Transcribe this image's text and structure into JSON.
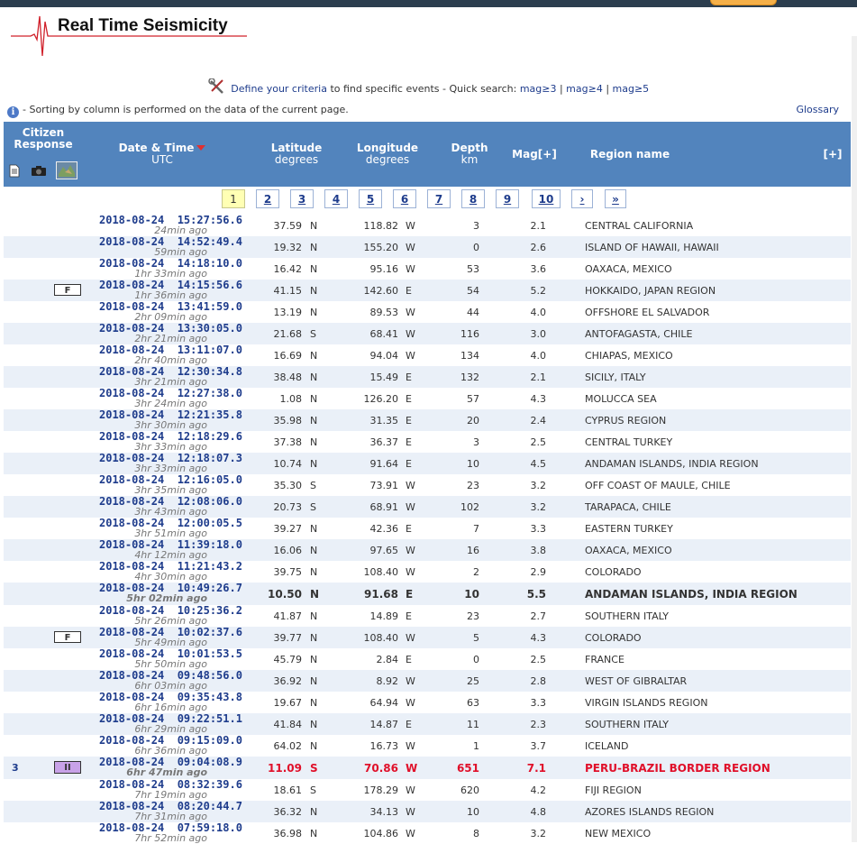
{
  "header": {
    "title": "Real Time Seismicity",
    "criteria_link": "Define your criteria",
    "criteria_text": " to find specific events - Quick search: ",
    "quick": [
      "mag≥3",
      "mag≥4",
      "mag≥5"
    ],
    "sep": " | ",
    "info_text": "- Sorting by column is performed on the data of the current page.",
    "glossary": "Glossary"
  },
  "table_header": {
    "citizen": "Citizen",
    "response": "Response",
    "date_time": "Date & Time",
    "utc": "UTC",
    "latitude": "Latitude",
    "lat_unit": "degrees",
    "longitude": "Longitude",
    "lon_unit": "degrees",
    "depth": "Depth",
    "depth_unit": "km",
    "mag": "Mag[+]",
    "region": "Region name",
    "expand": "[+]"
  },
  "pager": [
    "1",
    "2",
    "3",
    "4",
    "5",
    "6",
    "7",
    "8",
    "9",
    "10",
    "›",
    "»"
  ],
  "current_page": "1",
  "colors": {
    "header_bg": "#5284bd",
    "link": "#1e3c8c",
    "highlight": "#e0102a",
    "alt_row": "#eaf0f8"
  },
  "events": [
    {
      "date": "2018-08-24",
      "time": "15:27:56.6",
      "ago": "24min ago",
      "lat": "37.59",
      "ns": "N",
      "lon": "118.82",
      "ew": "W",
      "depth": "3",
      "mag": "2.1",
      "region": "CENTRAL CALIFORNIA"
    },
    {
      "date": "2018-08-24",
      "time": "14:52:49.4",
      "ago": "59min ago",
      "lat": "19.32",
      "ns": "N",
      "lon": "155.20",
      "ew": "W",
      "depth": "0",
      "mag": "2.6",
      "region": "ISLAND OF HAWAII, HAWAII"
    },
    {
      "date": "2018-08-24",
      "time": "14:18:10.0",
      "ago": "1hr 33min ago",
      "lat": "16.42",
      "ns": "N",
      "lon": "95.16",
      "ew": "W",
      "depth": "53",
      "mag": "3.6",
      "region": "OAXACA, MEXICO"
    },
    {
      "date": "2018-08-24",
      "time": "14:15:56.6",
      "ago": "1hr 36min ago",
      "lat": "41.15",
      "ns": "N",
      "lon": "142.60",
      "ew": "E",
      "depth": "54",
      "mag": "5.2",
      "region": "HOKKAIDO, JAPAN REGION",
      "badge": "F"
    },
    {
      "date": "2018-08-24",
      "time": "13:41:59.0",
      "ago": "2hr 09min ago",
      "lat": "13.19",
      "ns": "N",
      "lon": "89.53",
      "ew": "W",
      "depth": "44",
      "mag": "4.0",
      "region": "OFFSHORE EL SALVADOR"
    },
    {
      "date": "2018-08-24",
      "time": "13:30:05.0",
      "ago": "2hr 21min ago",
      "lat": "21.68",
      "ns": "S",
      "lon": "68.41",
      "ew": "W",
      "depth": "116",
      "mag": "3.0",
      "region": "ANTOFAGASTA, CHILE"
    },
    {
      "date": "2018-08-24",
      "time": "13:11:07.0",
      "ago": "2hr 40min ago",
      "lat": "16.69",
      "ns": "N",
      "lon": "94.04",
      "ew": "W",
      "depth": "134",
      "mag": "4.0",
      "region": "CHIAPAS, MEXICO"
    },
    {
      "date": "2018-08-24",
      "time": "12:30:34.8",
      "ago": "3hr 21min ago",
      "lat": "38.48",
      "ns": "N",
      "lon": "15.49",
      "ew": "E",
      "depth": "132",
      "mag": "2.1",
      "region": "SICILY, ITALY"
    },
    {
      "date": "2018-08-24",
      "time": "12:27:38.0",
      "ago": "3hr 24min ago",
      "lat": "1.08",
      "ns": "N",
      "lon": "126.20",
      "ew": "E",
      "depth": "57",
      "mag": "4.3",
      "region": "MOLUCCA SEA"
    },
    {
      "date": "2018-08-24",
      "time": "12:21:35.8",
      "ago": "3hr 30min ago",
      "lat": "35.98",
      "ns": "N",
      "lon": "31.35",
      "ew": "E",
      "depth": "20",
      "mag": "2.4",
      "region": "CYPRUS REGION"
    },
    {
      "date": "2018-08-24",
      "time": "12:18:29.6",
      "ago": "3hr 33min ago",
      "lat": "37.38",
      "ns": "N",
      "lon": "36.37",
      "ew": "E",
      "depth": "3",
      "mag": "2.5",
      "region": "CENTRAL TURKEY"
    },
    {
      "date": "2018-08-24",
      "time": "12:18:07.3",
      "ago": "3hr 33min ago",
      "lat": "10.74",
      "ns": "N",
      "lon": "91.64",
      "ew": "E",
      "depth": "10",
      "mag": "4.5",
      "region": "ANDAMAN ISLANDS, INDIA REGION"
    },
    {
      "date": "2018-08-24",
      "time": "12:16:05.0",
      "ago": "3hr 35min ago",
      "lat": "35.30",
      "ns": "S",
      "lon": "73.91",
      "ew": "W",
      "depth": "23",
      "mag": "3.2",
      "region": "OFF COAST OF MAULE, CHILE"
    },
    {
      "date": "2018-08-24",
      "time": "12:08:06.0",
      "ago": "3hr 43min ago",
      "lat": "20.73",
      "ns": "S",
      "lon": "68.91",
      "ew": "W",
      "depth": "102",
      "mag": "3.2",
      "region": "TARAPACA, CHILE"
    },
    {
      "date": "2018-08-24",
      "time": "12:00:05.5",
      "ago": "3hr 51min ago",
      "lat": "39.27",
      "ns": "N",
      "lon": "42.36",
      "ew": "E",
      "depth": "7",
      "mag": "3.3",
      "region": "EASTERN TURKEY"
    },
    {
      "date": "2018-08-24",
      "time": "11:39:18.0",
      "ago": "4hr 12min ago",
      "lat": "16.06",
      "ns": "N",
      "lon": "97.65",
      "ew": "W",
      "depth": "16",
      "mag": "3.8",
      "region": "OAXACA, MEXICO"
    },
    {
      "date": "2018-08-24",
      "time": "11:21:43.2",
      "ago": "4hr 30min ago",
      "lat": "39.75",
      "ns": "N",
      "lon": "108.40",
      "ew": "W",
      "depth": "2",
      "mag": "2.9",
      "region": "COLORADO"
    },
    {
      "date": "2018-08-24",
      "time": "10:49:26.7",
      "ago": "5hr 02min ago",
      "lat": "10.50",
      "ns": "N",
      "lon": "91.68",
      "ew": "E",
      "depth": "10",
      "mag": "5.5",
      "region": "ANDAMAN ISLANDS, INDIA REGION",
      "style": "bold"
    },
    {
      "date": "2018-08-24",
      "time": "10:25:36.2",
      "ago": "5hr 26min ago",
      "lat": "41.87",
      "ns": "N",
      "lon": "14.89",
      "ew": "E",
      "depth": "23",
      "mag": "2.7",
      "region": "SOUTHERN ITALY"
    },
    {
      "date": "2018-08-24",
      "time": "10:02:37.6",
      "ago": "5hr 49min ago",
      "lat": "39.77",
      "ns": "N",
      "lon": "108.40",
      "ew": "W",
      "depth": "5",
      "mag": "4.3",
      "region": "COLORADO",
      "badge": "F"
    },
    {
      "date": "2018-08-24",
      "time": "10:01:53.5",
      "ago": "5hr 50min ago",
      "lat": "45.79",
      "ns": "N",
      "lon": "2.84",
      "ew": "E",
      "depth": "0",
      "mag": "2.5",
      "region": "FRANCE"
    },
    {
      "date": "2018-08-24",
      "time": "09:48:56.0",
      "ago": "6hr 03min ago",
      "lat": "36.92",
      "ns": "N",
      "lon": "8.92",
      "ew": "W",
      "depth": "25",
      "mag": "2.8",
      "region": "WEST OF GIBRALTAR"
    },
    {
      "date": "2018-08-24",
      "time": "09:35:43.8",
      "ago": "6hr 16min ago",
      "lat": "19.67",
      "ns": "N",
      "lon": "64.94",
      "ew": "W",
      "depth": "63",
      "mag": "3.3",
      "region": "VIRGIN ISLANDS REGION"
    },
    {
      "date": "2018-08-24",
      "time": "09:22:51.1",
      "ago": "6hr 29min ago",
      "lat": "41.84",
      "ns": "N",
      "lon": "14.87",
      "ew": "E",
      "depth": "11",
      "mag": "2.3",
      "region": "SOUTHERN ITALY"
    },
    {
      "date": "2018-08-24",
      "time": "09:15:09.0",
      "ago": "6hr 36min ago",
      "lat": "64.02",
      "ns": "N",
      "lon": "16.73",
      "ew": "W",
      "depth": "1",
      "mag": "3.7",
      "region": "ICELAND"
    },
    {
      "date": "2018-08-24",
      "time": "09:04:08.9",
      "ago": "6hr 47min ago",
      "lat": "11.09",
      "ns": "S",
      "lon": "70.86",
      "ew": "W",
      "depth": "651",
      "mag": "7.1",
      "region": "PERU-BRAZIL BORDER REGION",
      "style": "red",
      "count": "3",
      "intensity": "II"
    },
    {
      "date": "2018-08-24",
      "time": "08:32:39.6",
      "ago": "7hr 19min ago",
      "lat": "18.61",
      "ns": "S",
      "lon": "178.29",
      "ew": "W",
      "depth": "620",
      "mag": "4.2",
      "region": "FIJI REGION"
    },
    {
      "date": "2018-08-24",
      "time": "08:20:44.7",
      "ago": "7hr 31min ago",
      "lat": "36.32",
      "ns": "N",
      "lon": "34.13",
      "ew": "W",
      "depth": "10",
      "mag": "4.8",
      "region": "AZORES ISLANDS REGION"
    },
    {
      "date": "2018-08-24",
      "time": "07:59:18.0",
      "ago": "7hr 52min ago",
      "lat": "36.98",
      "ns": "N",
      "lon": "104.86",
      "ew": "W",
      "depth": "8",
      "mag": "3.2",
      "region": "NEW MEXICO"
    }
  ]
}
